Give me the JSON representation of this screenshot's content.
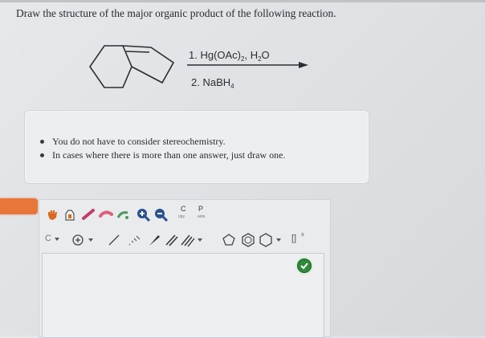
{
  "question": {
    "prompt": "Draw the structure of the major organic product of the following reaction."
  },
  "reaction": {
    "step1": "1. Hg(OAc)",
    "step1_sub": "2",
    "step1_mid": ", H",
    "step1_sub2": "2",
    "step1_end": "O",
    "step2": "2. NaBH",
    "step2_sub": "4"
  },
  "notes": {
    "items": [
      "You do not have to consider stereochemistry.",
      "In cases where there is more than one answer, just draw one."
    ]
  },
  "toolbar": {
    "copy_letter": "C",
    "copy_label": "opy",
    "paste_letter": "P",
    "paste_label": "aste",
    "charge_label": "[]",
    "charge_sup": "±",
    "c_atom": "C"
  },
  "colors": {
    "accent_orange": "#e87638",
    "ok_green": "#2f8a3a",
    "hand_orange": "#d96a1c",
    "pencil_pink": "#c43b6e",
    "eraser_pink": "#e0607f",
    "lasso_green": "#4c9a5a",
    "zoom_blue": "#2b4f8f"
  }
}
